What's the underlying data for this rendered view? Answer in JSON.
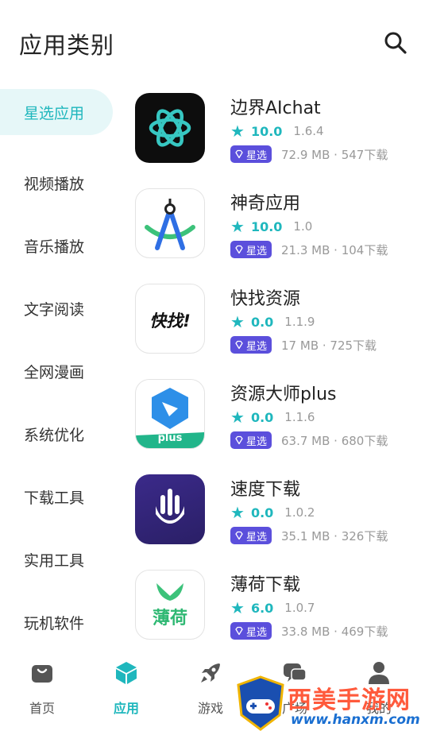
{
  "header": {
    "title": "应用类别"
  },
  "sidebar": {
    "items": [
      {
        "label": "星选应用"
      },
      {
        "label": "视频播放"
      },
      {
        "label": "音乐播放"
      },
      {
        "label": "文字阅读"
      },
      {
        "label": "全网漫画"
      },
      {
        "label": "系统优化"
      },
      {
        "label": "下载工具"
      },
      {
        "label": "实用工具"
      },
      {
        "label": "玩机软件"
      }
    ]
  },
  "apps": [
    {
      "name": "边界AIchat",
      "rating": "10.0",
      "version": "1.6.4",
      "badge": "星选",
      "meta": "72.9 MB · 547下载"
    },
    {
      "name": "神奇应用",
      "rating": "10.0",
      "version": "1.0",
      "badge": "星选",
      "meta": "21.3 MB · 104下载"
    },
    {
      "name": "快找资源",
      "rating": "0.0",
      "version": "1.1.9",
      "badge": "星选",
      "meta": "17 MB · 725下载"
    },
    {
      "name": "资源大师plus",
      "rating": "0.0",
      "version": "1.1.6",
      "badge": "星选",
      "meta": "63.7 MB · 680下载"
    },
    {
      "name": "速度下载",
      "rating": "0.0",
      "version": "1.0.2",
      "badge": "星选",
      "meta": "35.1 MB · 326下载"
    },
    {
      "name": "薄荷下载",
      "rating": "6.0",
      "version": "1.0.7",
      "badge": "星选",
      "meta": "33.8 MB · 469下载"
    }
  ],
  "icon_text": {
    "kuaizhao": "快找!",
    "plus": "plus",
    "bohe": "薄荷"
  },
  "tabs": [
    {
      "label": "首页",
      "icon": "bag-icon"
    },
    {
      "label": "应用",
      "icon": "cube-icon"
    },
    {
      "label": "游戏",
      "icon": "rocket-icon"
    },
    {
      "label": "广场",
      "icon": "chat-icon"
    },
    {
      "label": "我的",
      "icon": "user-icon"
    }
  ],
  "watermark": {
    "title": "西美手游网",
    "url": "www.hanxm.com"
  },
  "colors": {
    "accent": "#1fb7bd",
    "badge": "#5b4fdc",
    "watermark_title": "#ff5a3c",
    "watermark_url": "#1a6fd1"
  }
}
